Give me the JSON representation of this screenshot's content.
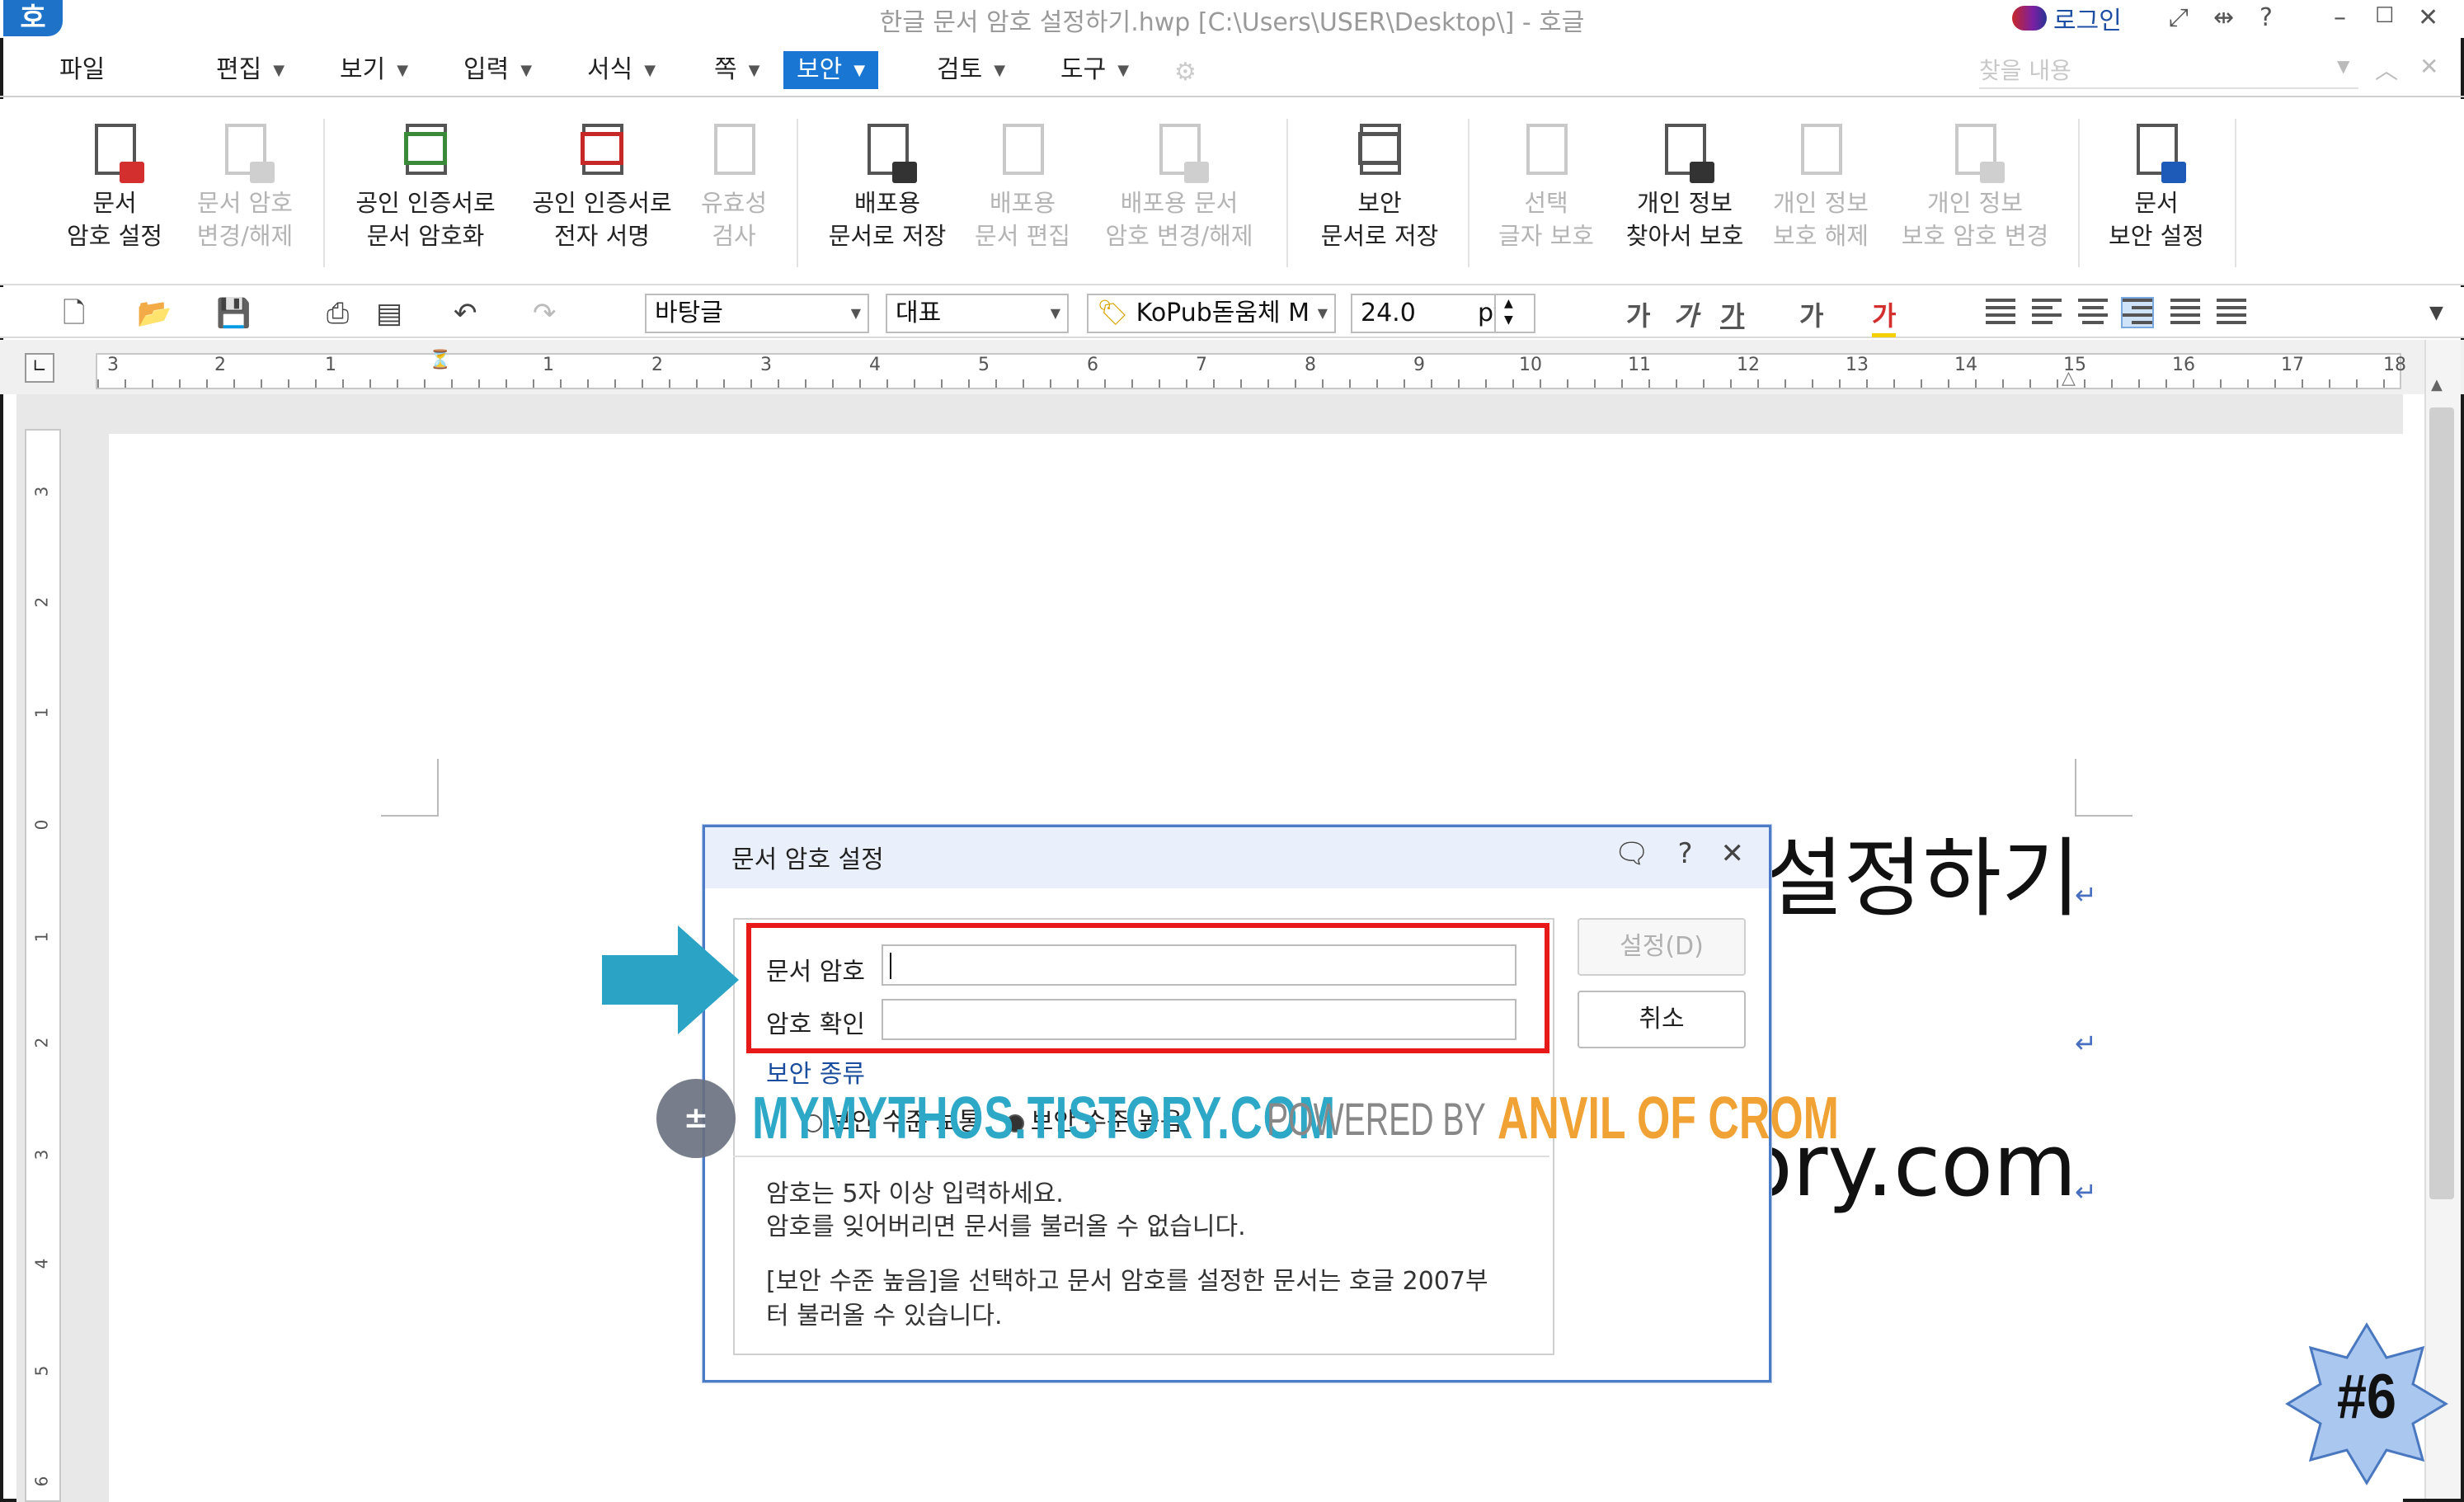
{
  "window": {
    "app_logo": "호",
    "title": "한글 문서 암호 설정하기.hwp [C:\\Users\\USER\\Desktop\\] - 호글",
    "login": "로그인",
    "controls": [
      "⤢",
      "⇹",
      "?",
      "–",
      "☐",
      "✕"
    ]
  },
  "menu": {
    "items": [
      "파일",
      "편집",
      "보기",
      "입력",
      "서식",
      "쪽",
      "보안",
      "검토",
      "도구"
    ],
    "active": "보안",
    "search_placeholder": "찾을 내용"
  },
  "ribbon": {
    "buttons": [
      {
        "line1": "문서",
        "line2": "암호 설정",
        "enabled": true,
        "icon": "doc-lock-icon"
      },
      {
        "line1": "문서 암호",
        "line2": "변경/해제",
        "enabled": false,
        "icon": "doc-lock-change-icon"
      },
      {
        "line1": "공인 인증서로",
        "line2": "문서 암호화",
        "enabled": true,
        "icon": "cert-encrypt-icon"
      },
      {
        "line1": "공인 인증서로",
        "line2": "전자 서명",
        "enabled": true,
        "icon": "cert-sign-icon"
      },
      {
        "line1": "유효성",
        "line2": "검사",
        "enabled": false,
        "icon": "validate-icon"
      },
      {
        "line1": "배포용",
        "line2": "문서로 저장",
        "enabled": true,
        "icon": "distribute-save-icon"
      },
      {
        "line1": "배포용",
        "line2": "문서 편집",
        "enabled": false,
        "icon": "distribute-edit-icon"
      },
      {
        "line1": "배포용 문서",
        "line2": "암호 변경/해제",
        "enabled": false,
        "icon": "distribute-lock-icon"
      },
      {
        "line1": "보안",
        "line2": "문서로 저장",
        "enabled": true,
        "icon": "secure-save-icon"
      },
      {
        "line1": "선택",
        "line2": "글자 보호",
        "enabled": false,
        "icon": "select-protect-icon"
      },
      {
        "line1": "개인 정보",
        "line2": "찾아서 보호",
        "enabled": true,
        "icon": "privacy-find-icon"
      },
      {
        "line1": "개인 정보",
        "line2": "보호 해제",
        "enabled": false,
        "icon": "privacy-unprotect-icon"
      },
      {
        "line1": "개인 정보",
        "line2": "보호 암호 변경",
        "enabled": false,
        "icon": "privacy-password-icon"
      },
      {
        "line1": "문서",
        "line2": "보안 설정",
        "enabled": true,
        "icon": "doc-security-icon"
      }
    ]
  },
  "toolbar": {
    "style": "바탕글",
    "lang": "대표",
    "font": "KoPub돋움체 M",
    "size": "24.0",
    "unit": "pt",
    "fmt": [
      "가",
      "가",
      "가",
      "가",
      "가"
    ]
  },
  "ruler": {
    "numbers": [
      "3",
      "2",
      "1",
      "1",
      "2",
      "3",
      "4",
      "5",
      "6",
      "7",
      "8",
      "9",
      "10",
      "11",
      "12",
      "13",
      "14",
      "15",
      "16",
      "17",
      "18"
    ],
    "vnumbers": [
      "3",
      "2",
      "1",
      "0",
      "1",
      "2",
      "3",
      "4",
      "5",
      "6"
    ]
  },
  "document": {
    "title_fragment": "설정하기",
    "url_fragment": "ory.com",
    "return_mark": "↵"
  },
  "dialog": {
    "title": "문서 암호 설정",
    "password_label": "문서 암호",
    "confirm_label": "암호 확인",
    "password_value": "",
    "confirm_value": "",
    "set_button": "설정(D)",
    "cancel_button": "취소",
    "security_type_label": "보안 종류",
    "option_normal": "보안 수준 보통",
    "option_high": "보안 수준 높음",
    "note1": "암호는 5자 이상 입력하세요.",
    "note2": "암호를 잊어버리면 문서를 불러올 수 없습니다.",
    "note3": "[보안 수준 높음]을 선택하고 문서 암호를 설정한 문서는 호글 2007부",
    "note4": "터 불러올 수 있습니다."
  },
  "watermark": {
    "site": "MYMYTHOS.TISTORY.COM",
    "powered": "POWERED BY",
    "brand": "ANVIL OF CROM"
  },
  "badge": {
    "text": "#6"
  },
  "colors": {
    "accent": "#1976d2",
    "highlight": "#e81919",
    "arrow": "#2aa3c4",
    "badge": "#aac8ef"
  }
}
